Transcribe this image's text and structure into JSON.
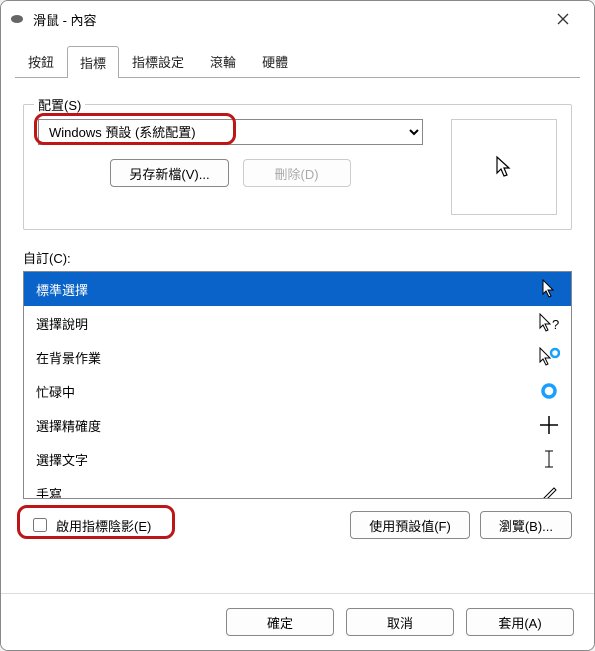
{
  "window": {
    "title": "滑鼠 - 內容"
  },
  "tabs": [
    "按鈕",
    "指標",
    "指標設定",
    "滾輪",
    "硬體"
  ],
  "active_tab": 1,
  "scheme": {
    "group_label": "配置(S)",
    "selected": "Windows 預設 (系統配置)",
    "save_as": "另存新檔(V)...",
    "delete": "刪除(D)"
  },
  "custom": {
    "label": "自訂(C):",
    "items": [
      {
        "label": "標準選擇",
        "selected": true,
        "icon": "arrow"
      },
      {
        "label": "選擇說明",
        "selected": false,
        "icon": "arrow-help"
      },
      {
        "label": "在背景作業",
        "selected": false,
        "icon": "arrow-ring"
      },
      {
        "label": "忙碌中",
        "selected": false,
        "icon": "ring"
      },
      {
        "label": "選擇精確度",
        "selected": false,
        "icon": "cross"
      },
      {
        "label": "選擇文字",
        "selected": false,
        "icon": "ibeam"
      },
      {
        "label": "手寫",
        "selected": false,
        "icon": "pen"
      }
    ]
  },
  "shadow_checkbox": "啟用指標陰影(E)",
  "use_default": "使用預設值(F)",
  "browse": "瀏覽(B)...",
  "footer": {
    "ok": "確定",
    "cancel": "取消",
    "apply": "套用(A)"
  }
}
